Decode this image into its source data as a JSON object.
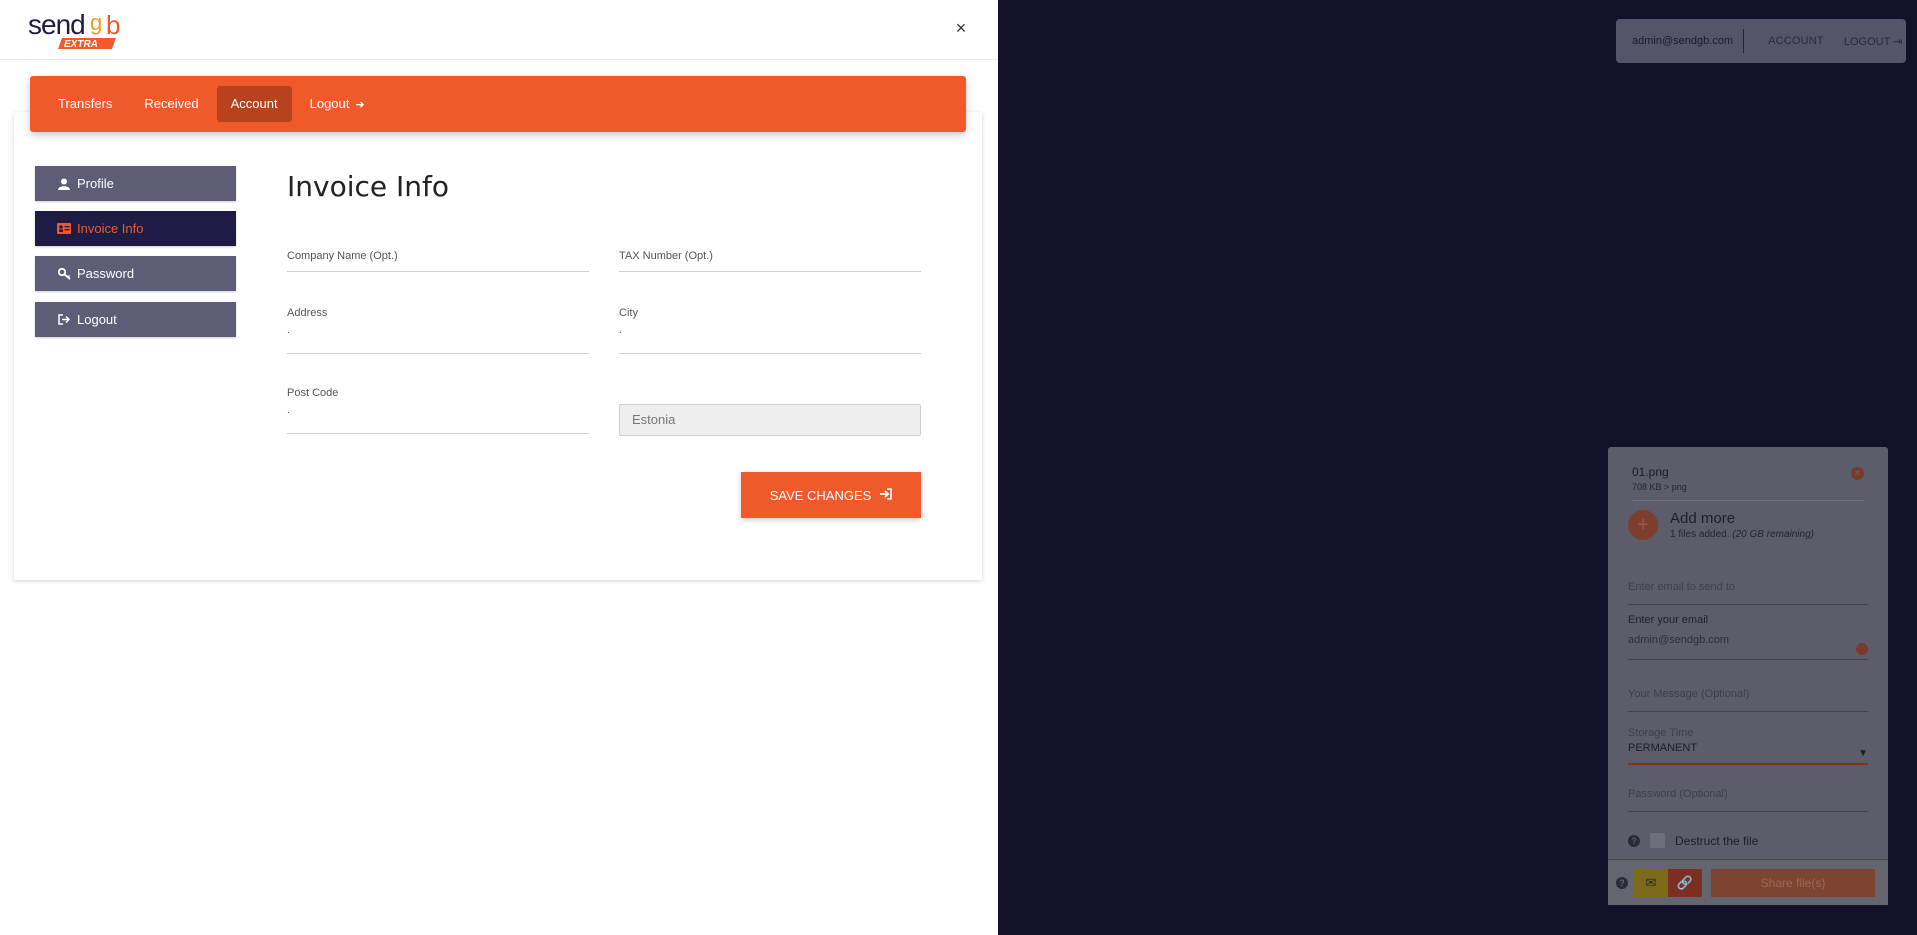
{
  "brand": {
    "name": "sendgb",
    "badge": "EXTRA",
    "accent": "#f05a2b",
    "dark": "#1e1c44"
  },
  "header": {
    "close_label": "×"
  },
  "nav": {
    "items": [
      {
        "label": "Transfers"
      },
      {
        "label": "Received"
      },
      {
        "label": "Account"
      },
      {
        "label": "Logout"
      }
    ],
    "active": "Account"
  },
  "sidebar": {
    "items": [
      {
        "label": "Profile",
        "icon": "user-icon"
      },
      {
        "label": "Invoice Info",
        "icon": "id-card-icon"
      },
      {
        "label": "Password",
        "icon": "key-icon"
      },
      {
        "label": "Logout",
        "icon": "sign-out-icon"
      }
    ],
    "active": "Invoice Info"
  },
  "form": {
    "title": "Invoice Info",
    "company": {
      "label": "Company Name (Opt.)",
      "value": ""
    },
    "tax": {
      "label": "TAX Number (Opt.)",
      "value": ""
    },
    "address": {
      "label": "Address",
      "value": "."
    },
    "city": {
      "label": "City",
      "value": "."
    },
    "postcode": {
      "label": "Post Code",
      "value": "."
    },
    "country": {
      "value": "Estonia"
    },
    "save_label": "SAVE CHANGES"
  },
  "background": {
    "topbar": {
      "email": "admin@sendgb.com",
      "account": "ACCOUNT",
      "logout": "LOGOUT"
    },
    "upload": {
      "file_name": "01.png",
      "file_meta": "708 KB > png",
      "add_more": "Add more",
      "files_added": "1 files added.",
      "remaining": "(20 GB remaining)",
      "send_to_placeholder": "Enter email to send to",
      "your_email_label": "Enter your email",
      "your_email_value": "admin@sendgb.com",
      "message_placeholder": "Your Message (Optional)",
      "storage_label": "Storage Time",
      "storage_value": "PERMANENT",
      "password_placeholder": "Password (Optional)",
      "destruct_label": "Destruct the file",
      "share_label": "Share file(s)"
    }
  }
}
